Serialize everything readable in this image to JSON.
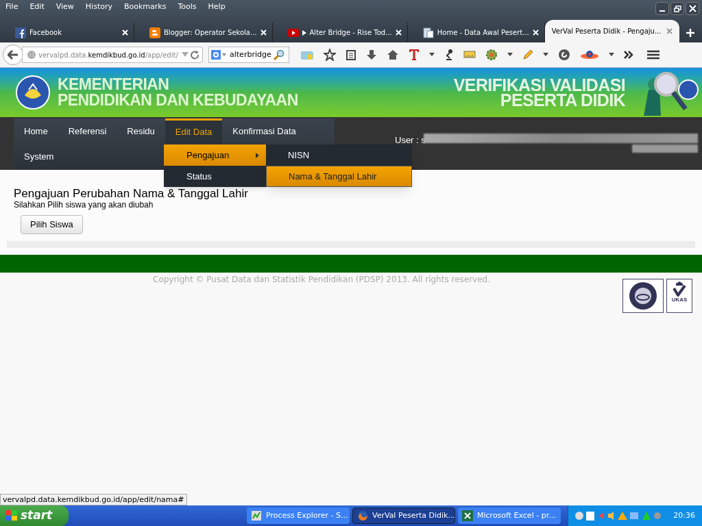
{
  "menubar": [
    "File",
    "Edit",
    "View",
    "History",
    "Bookmarks",
    "Tools",
    "Help"
  ],
  "tabs": [
    {
      "title": "Facebook",
      "kind": "facebook",
      "playing": false,
      "selected": false
    },
    {
      "title": "Blogger: Operator Sekola...",
      "kind": "blogger",
      "playing": false,
      "selected": false
    },
    {
      "title": "Alter Bridge - Rise Tod...",
      "kind": "video",
      "playing": true,
      "selected": false
    },
    {
      "title": "Home - Data Awal Pesert...",
      "kind": "document",
      "playing": false,
      "selected": false
    },
    {
      "title": "VerVal Peserta Didik - Pengaju...",
      "kind": "plain",
      "playing": false,
      "selected": true
    }
  ],
  "address": {
    "url": "vervalpd.data.**kemdikbud.go.id**/app/edit/"
  },
  "search": {
    "value": "alterbridge"
  },
  "header": {
    "ministry": [
      "KEMENTERIAN",
      "PENDIDIKAN DAN KEBUDAYAAN"
    ],
    "app_title": [
      "VERIFIKASI VALIDASI",
      "PESERTA DIDIK"
    ]
  },
  "nav": {
    "items": [
      {
        "label": "Home",
        "selected": false
      },
      {
        "label": "Referensi",
        "selected": false
      },
      {
        "label": "Residu",
        "selected": false
      },
      {
        "label": "Edit Data",
        "selected": true
      },
      {
        "label": "Konfirmasi Data",
        "selected": false
      },
      {
        "label": "System",
        "selected": false
      }
    ],
    "user_label": "User : s"
  },
  "dropdown": [
    {
      "label": "Pengajuan",
      "selected": true,
      "has_submenu": true
    },
    {
      "label": "Status",
      "selected": false,
      "has_submenu": false
    }
  ],
  "submenu": [
    {
      "label": "NISN",
      "selected": false
    },
    {
      "label": "Nama & Tanggal Lahir",
      "selected": true
    }
  ],
  "content": {
    "title": "Pengajuan Perubahan Nama & Tanggal Lahir",
    "subtitle": "Silahkan Pilih siswa yang akan diubah",
    "button": "Pilih Siswa"
  },
  "footer": {
    "copyright": "Copyright © Pusat Data dan Statistik Pendidikan (PDSP) 2013. All rights reserved.",
    "badge": "UKAS"
  },
  "status_url": "vervalpd.data.kemdikbud.go.id/app/edit/nama#",
  "taskbar": {
    "start": "start",
    "items": [
      {
        "title": "Process Explorer - S...",
        "kind": "process",
        "selected": false
      },
      {
        "title": "VerVal Peserta Didik...",
        "kind": "browser",
        "selected": true
      },
      {
        "title": "Microsoft Excel - pr...",
        "kind": "spreadsheet",
        "selected": false
      }
    ],
    "clock": "20:36"
  }
}
